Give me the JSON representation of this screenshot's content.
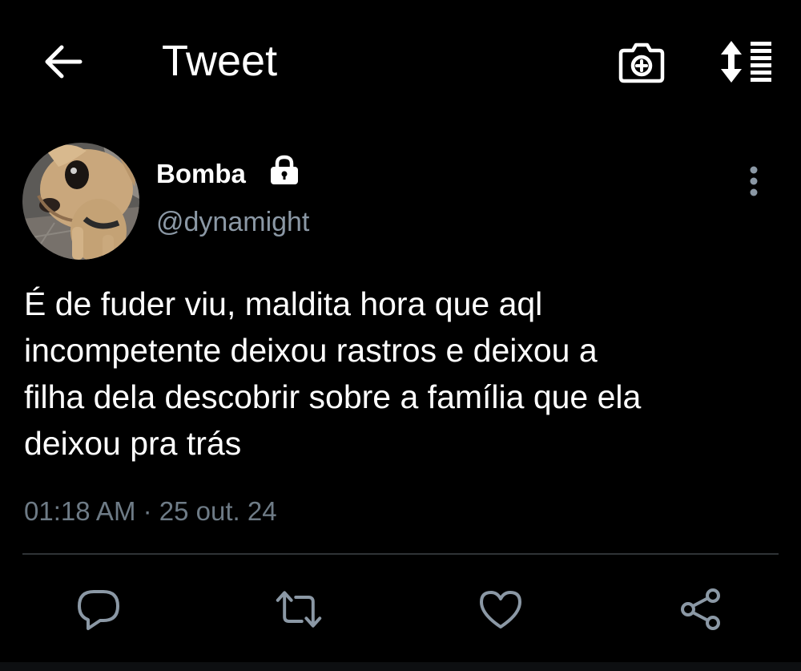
{
  "header": {
    "title": "Tweet",
    "back_icon": "arrow-left-icon",
    "camera_icon": "camera-plus-icon",
    "sort_icon": "sort-list-icon"
  },
  "tweet": {
    "display_name": "Bomba",
    "protected_icon": "lock-icon",
    "handle": "@dynamight",
    "avatar": "avatar-chihuahua",
    "text": "É de fuder viu, maldita hora que aql\nincompetente deixou rastros e deixou a\nfilha dela descobrir sobre a família que ela\ndeixou pra trás",
    "time": "01:18 AM",
    "separator": "·",
    "date": "25 out. 24"
  },
  "actions": [
    {
      "name": "reply",
      "icon": "reply-bubble-icon"
    },
    {
      "name": "retweet",
      "icon": "retweet-icon"
    },
    {
      "name": "like",
      "icon": "heart-icon"
    },
    {
      "name": "share",
      "icon": "share-icon"
    }
  ],
  "colors": {
    "background": "#000000",
    "primary_text": "#ffffff",
    "secondary_text": "#8b98a5",
    "timestamp_text": "#6e7b86",
    "divider": "#2f3336",
    "icon_muted": "#8b98a5"
  }
}
